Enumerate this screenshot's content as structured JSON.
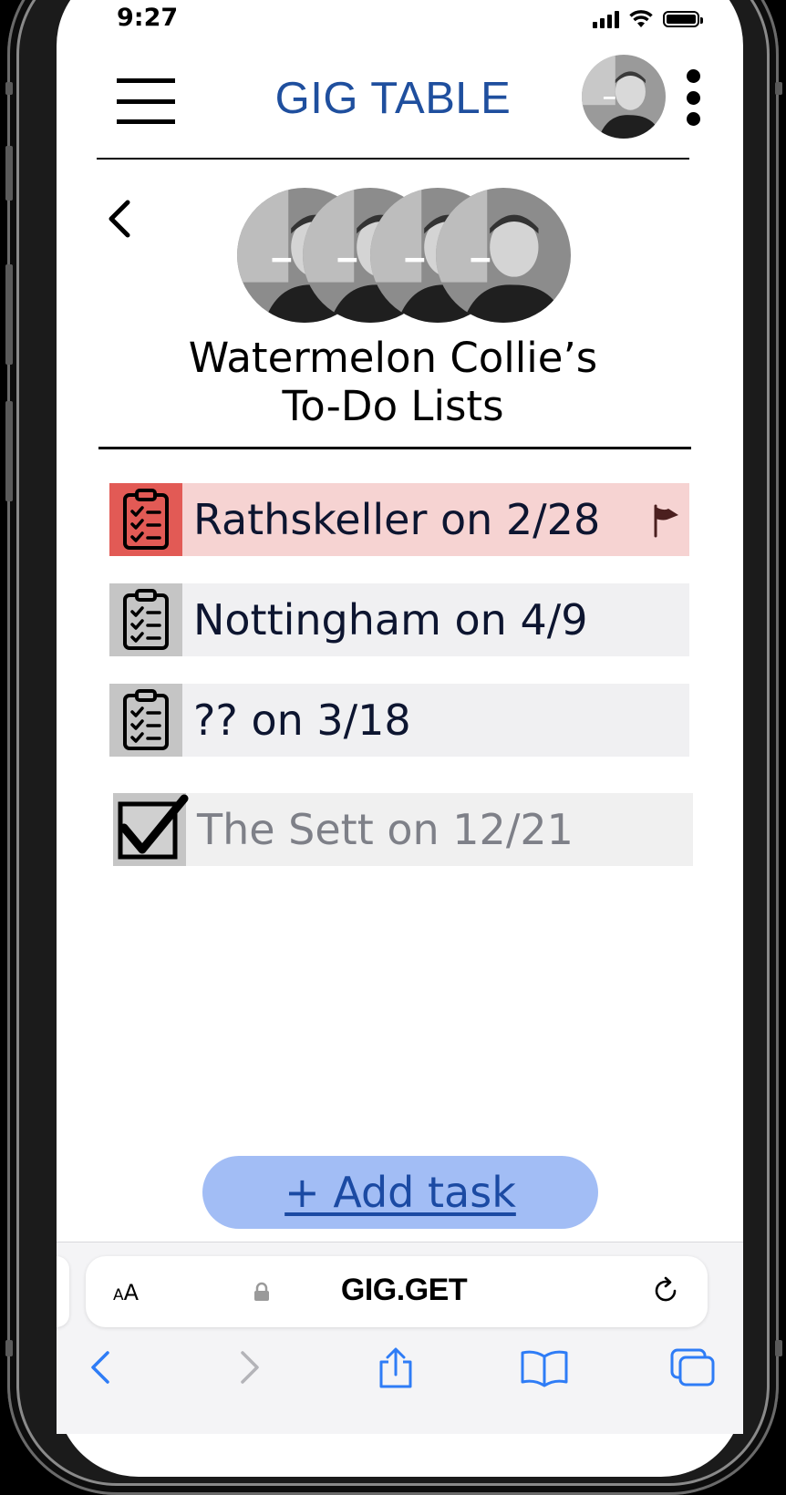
{
  "status_bar": {
    "time": "9:27"
  },
  "header": {
    "app_title": "GIG TABLE"
  },
  "list_header": {
    "title_line1": "Watermelon Collie’s",
    "title_line2": "To-Do Lists"
  },
  "lists": [
    {
      "label": "Rathskeller on 2/28",
      "status": "flagged",
      "color": "#e25a55"
    },
    {
      "label": "Nottingham on 4/9",
      "status": "open"
    },
    {
      "label": "?? on 3/18",
      "status": "open"
    },
    {
      "label": "The Sett on 12/21",
      "status": "completed"
    }
  ],
  "actions": {
    "add_task_label": "+ Add task"
  },
  "browser": {
    "text_size_label_big": "A",
    "text_size_label_small": "A",
    "url": "GIG.GET"
  },
  "colors": {
    "brand": "#1f4f9e",
    "add_button": "#a2bdf5",
    "flagged_bg": "#f6d3d2",
    "ios_blue": "#2e7cf6"
  }
}
